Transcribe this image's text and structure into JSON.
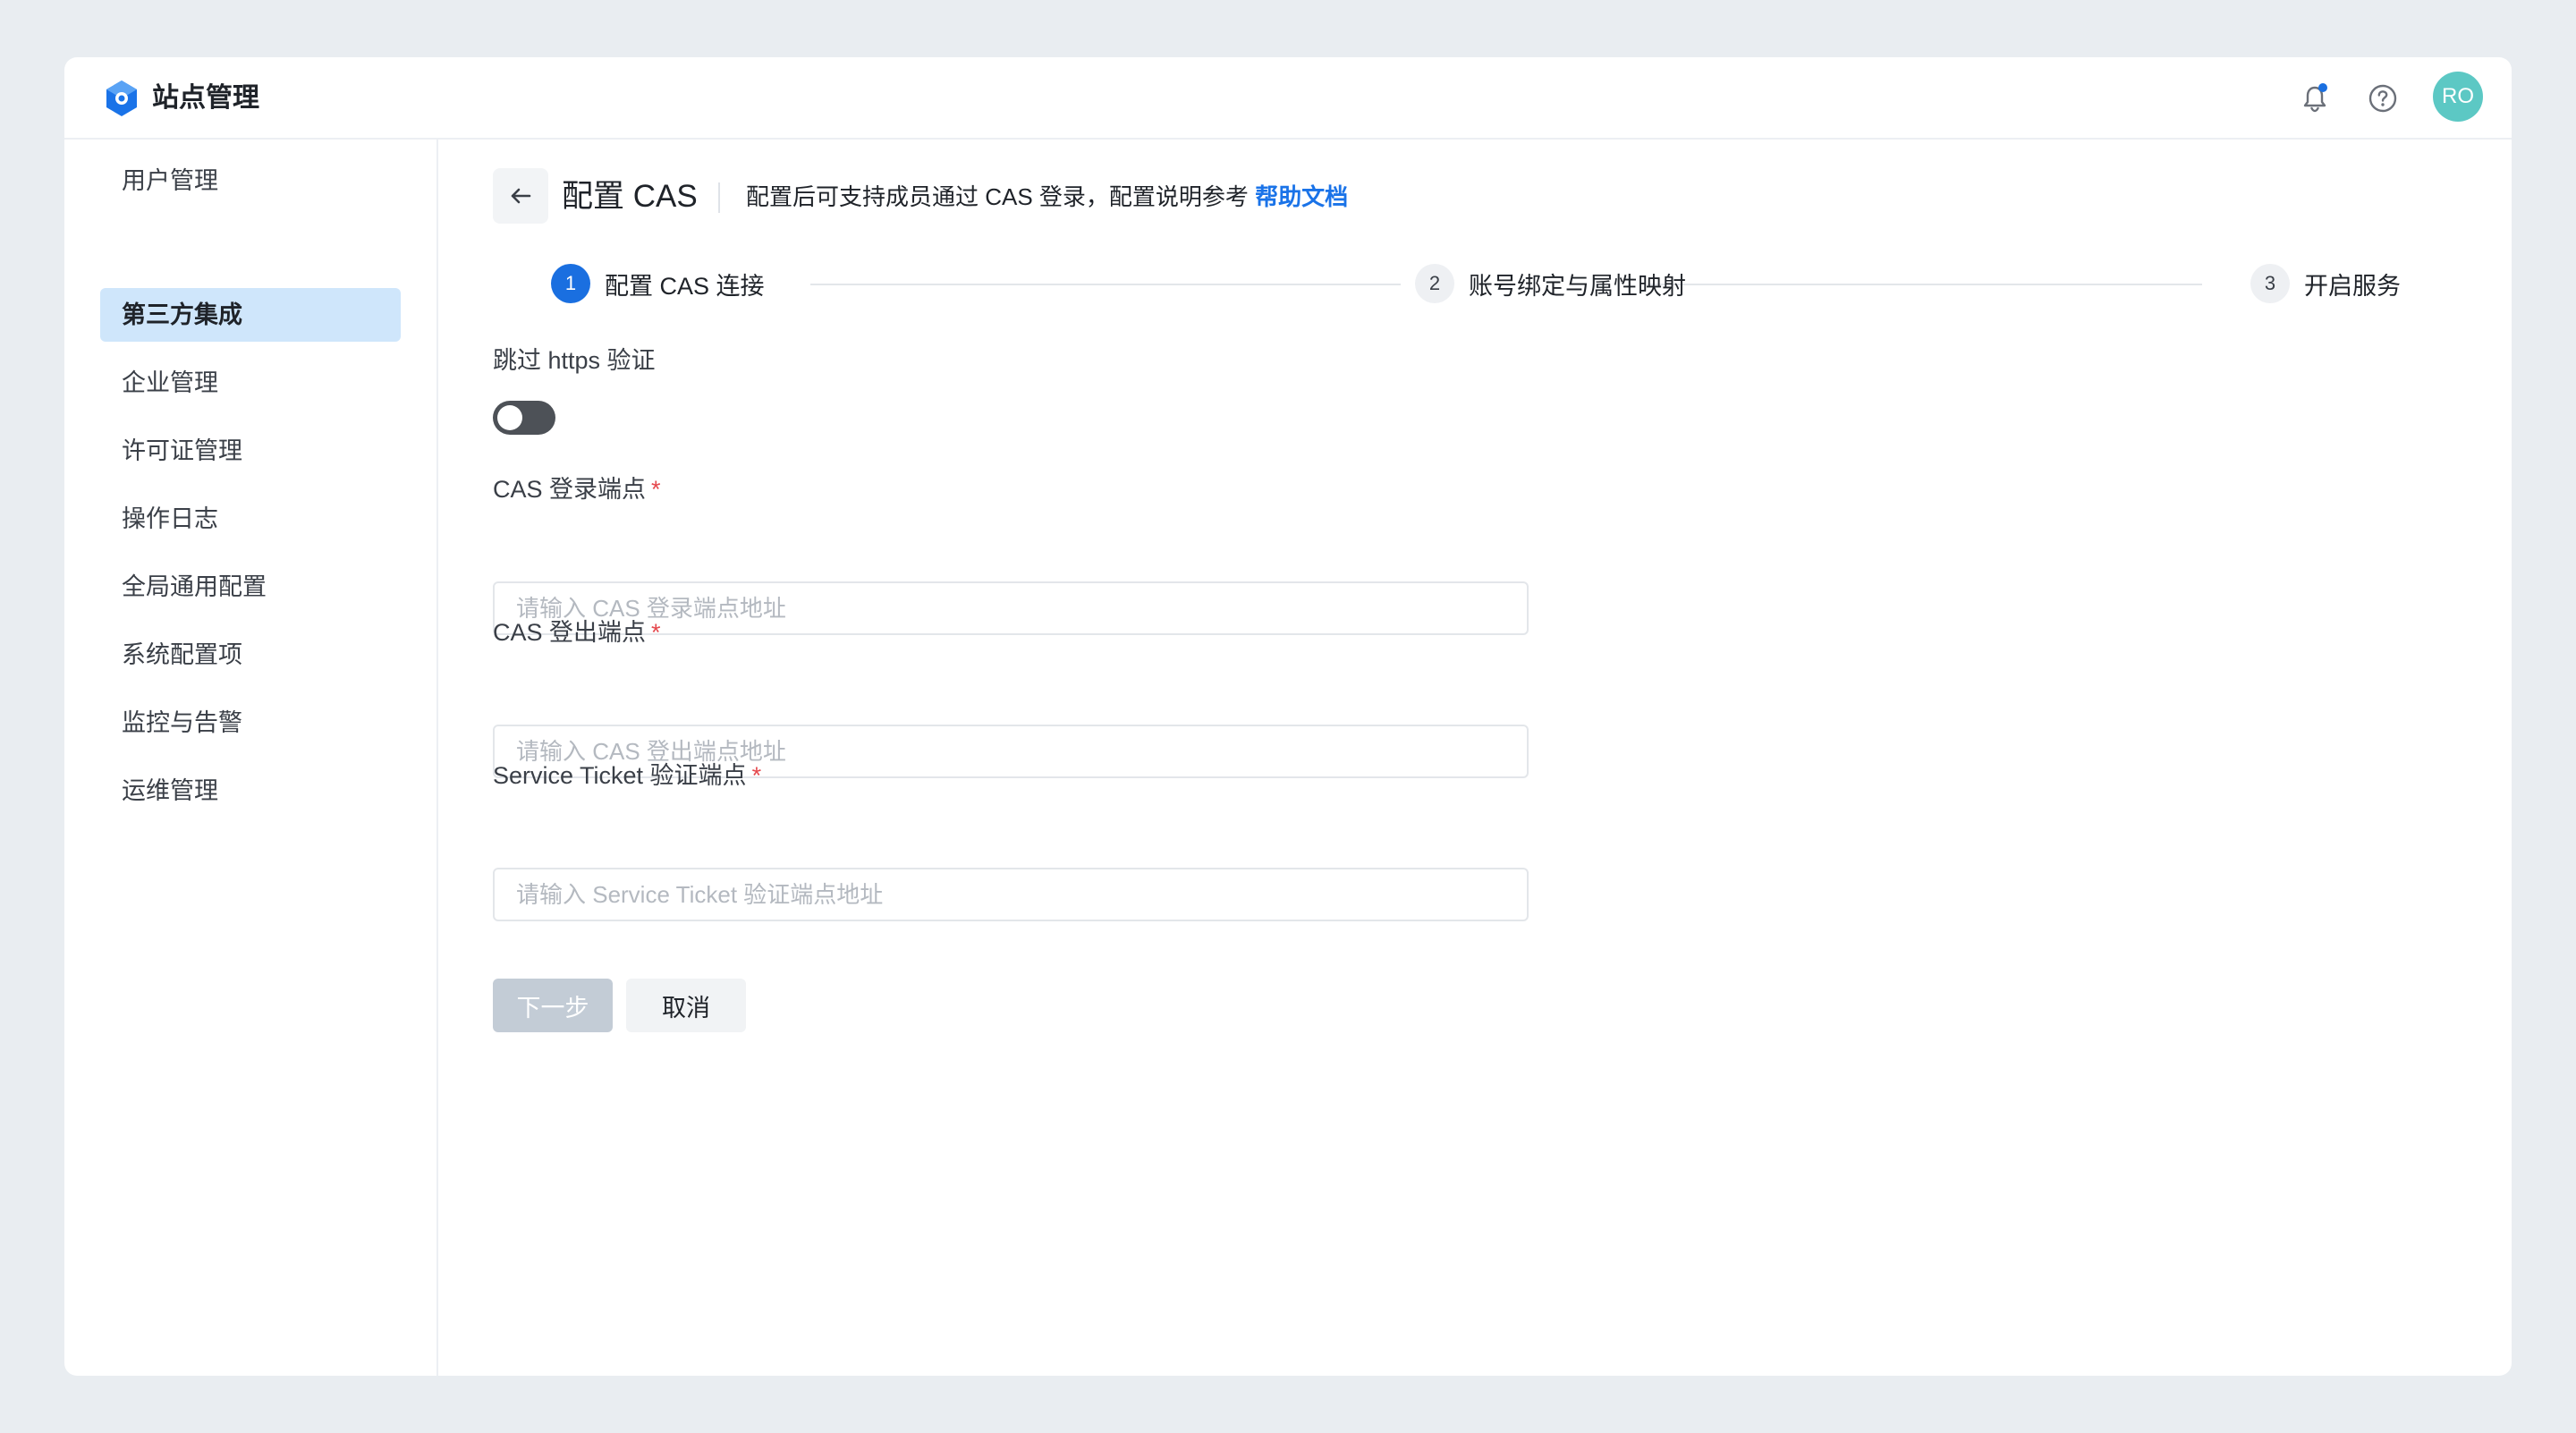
{
  "app": {
    "title": "站点管理"
  },
  "header": {
    "avatar_initials": "RO",
    "notification_dot_color": "#1a6fe0"
  },
  "sidebar": {
    "items": [
      {
        "label": "用户管理"
      },
      {
        "label": "第三方集成",
        "active": true
      },
      {
        "label": "企业管理"
      },
      {
        "label": "许可证管理"
      },
      {
        "label": "操作日志"
      },
      {
        "label": "全局通用配置"
      },
      {
        "label": "系统配置项"
      },
      {
        "label": "监控与告警"
      },
      {
        "label": "运维管理"
      }
    ]
  },
  "page": {
    "title": "配置 CAS",
    "description": "配置后可支持成员通过 CAS 登录，配置说明参考 ",
    "help_link": "帮助文档"
  },
  "steps": [
    {
      "number": "1",
      "label": "配置 CAS 连接",
      "active": true
    },
    {
      "number": "2",
      "label": "账号绑定与属性映射",
      "active": false
    },
    {
      "number": "3",
      "label": "开启服务",
      "active": false
    }
  ],
  "form": {
    "skip_https": {
      "label": "跳过 https 验证",
      "enabled": false
    },
    "login_endpoint": {
      "label": "CAS 登录端点",
      "required_mark": "*",
      "value": "",
      "placeholder": "请输入 CAS 登录端点地址"
    },
    "logout_endpoint": {
      "label": "CAS 登出端点",
      "required_mark": "*",
      "value": "",
      "placeholder": "请输入 CAS 登出端点地址"
    },
    "ticket_endpoint": {
      "label": "Service Ticket 验证端点",
      "required_mark": "*",
      "value": "",
      "placeholder": "请输入 Service Ticket 验证端点地址"
    }
  },
  "actions": {
    "next_label": "下一步",
    "cancel_label": "取消"
  },
  "colors": {
    "accent": "#1a73e8",
    "active_nav_bg": "#cfe6fb",
    "avatar_bg": "#5cc8c4",
    "required": "#e5484d"
  }
}
